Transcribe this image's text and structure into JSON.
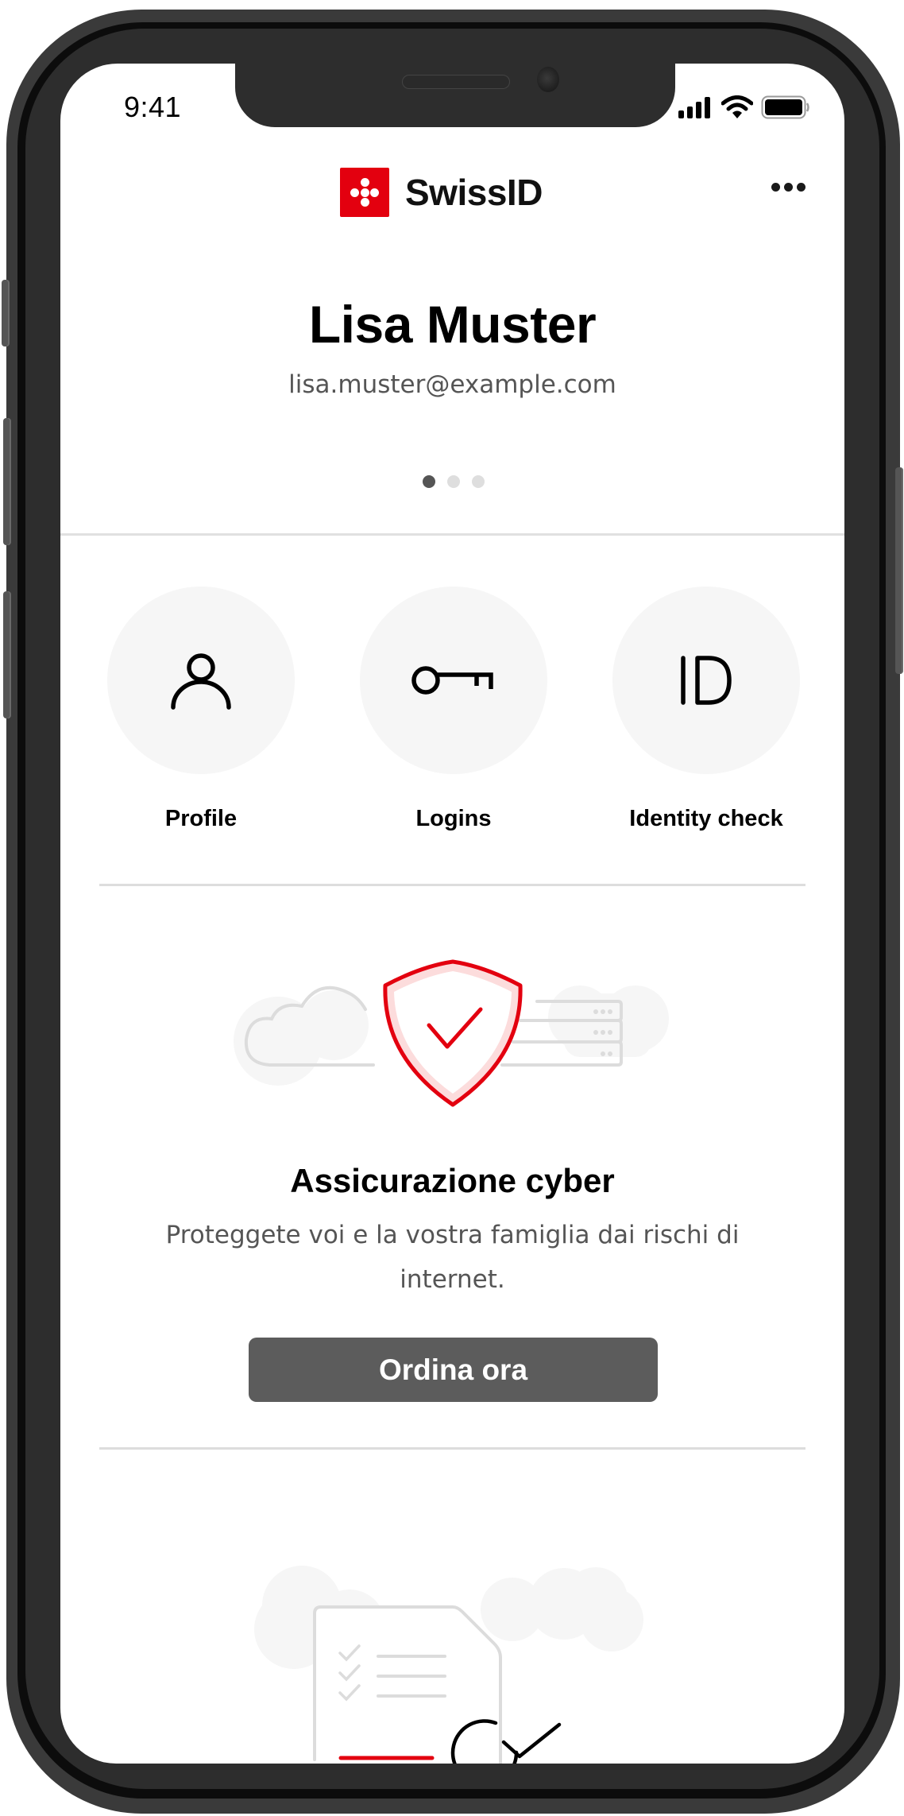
{
  "status_bar": {
    "time": "9:41",
    "icons": [
      "cellular-signal-icon",
      "wifi-icon",
      "battery-icon"
    ]
  },
  "header": {
    "brand": "SwissID",
    "logo_icon": "swiss-cross-dots-icon",
    "more_icon": "more-horizontal-icon"
  },
  "profile": {
    "name": "Lisa Muster",
    "email": "lisa.muster@example.com",
    "pager": {
      "total": 3,
      "active": 1
    }
  },
  "actions": [
    {
      "label": "Profile",
      "icon": "person-icon"
    },
    {
      "label": "Logins",
      "icon": "key-icon"
    },
    {
      "label": "Identity check",
      "icon": "id-icon",
      "glyph": "ID"
    }
  ],
  "promo": {
    "title": "Assicurazione cyber",
    "description": "Proteggete voi e la vostra famiglia dai rischi di internet.",
    "button_label": "Ordina ora",
    "illustration": "shield-check-cloud-server-illustration"
  },
  "next_card": {
    "illustration": "document-checklist-illustration"
  },
  "colors": {
    "brand_red": "#e3000f",
    "button_gray": "#5c5c5c",
    "circle_bg": "#f6f6f6",
    "divider": "#dddddd",
    "text_secondary": "#555555",
    "shield_fill": "#fcdcdc"
  }
}
